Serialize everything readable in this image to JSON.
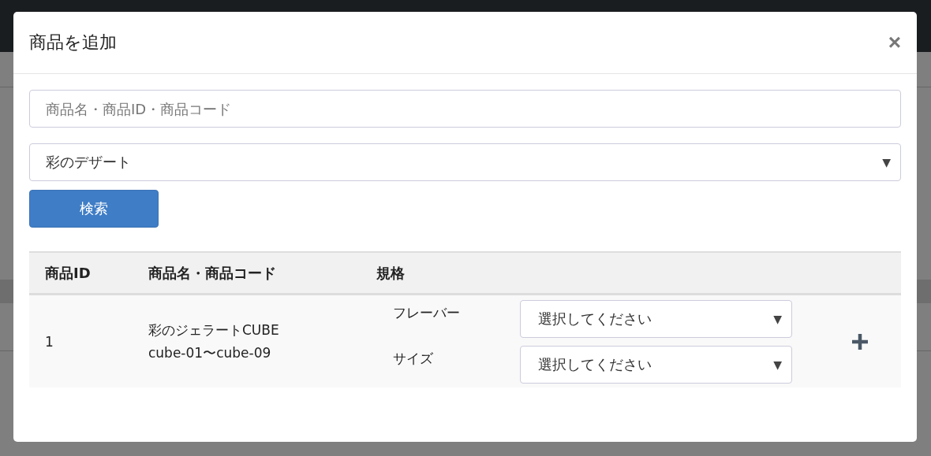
{
  "modal": {
    "title": "商品を追加",
    "close": "×"
  },
  "search": {
    "placeholder": "商品名・商品ID・商品コード"
  },
  "category": {
    "value": "彩のデザート",
    "arrow": "▼"
  },
  "search_button": "検索",
  "table": {
    "columns": [
      "商品ID",
      "商品名・商品コード",
      "規格"
    ],
    "rows": [
      {
        "id": "1",
        "name": "彩のジェラートCUBE",
        "code": "cube-01〜cube-09",
        "specs": [
          {
            "label": "フレーバー",
            "value": "選択してください",
            "arrow": "▼"
          },
          {
            "label": "サイズ",
            "value": "選択してください",
            "arrow": "▼"
          }
        ]
      }
    ]
  }
}
